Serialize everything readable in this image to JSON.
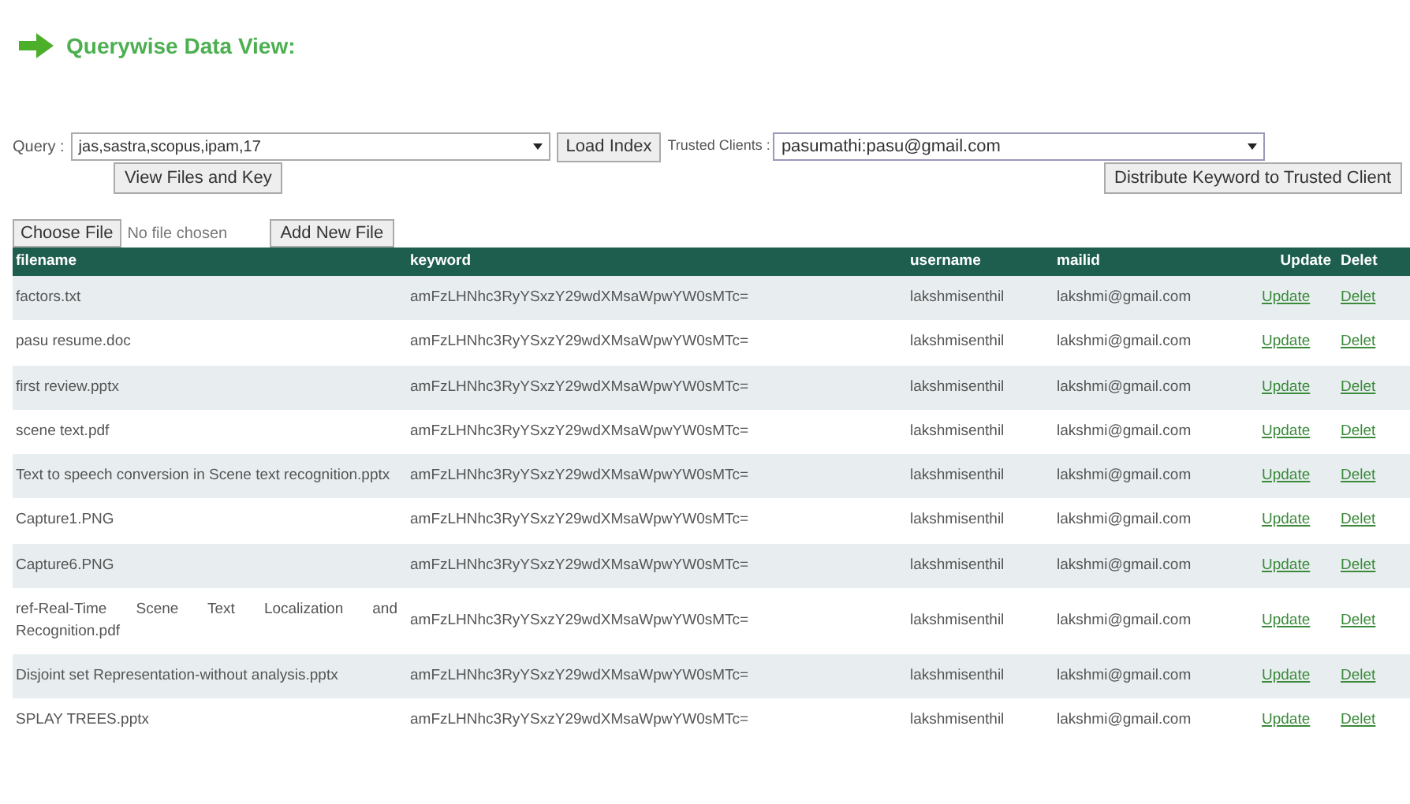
{
  "heading": "Querywise Data View:",
  "query": {
    "label": "Query :",
    "value": "jas,sastra,scopus,ipam,17"
  },
  "load_button": "Load Index",
  "trusted": {
    "label": "Trusted Clients :",
    "value": "pasumathi:pasu@gmail.com"
  },
  "view_button": "View Files and Key",
  "distribute_button": "Distribute Keyword to Trusted Client",
  "file_input": {
    "button": "Choose File",
    "status": "No file chosen"
  },
  "add_button": "Add New File",
  "table": {
    "columns": [
      "filename",
      "keyword",
      "username",
      "mailid",
      "Update",
      "Delet"
    ],
    "rows": [
      {
        "filename": "factors.txt",
        "keyword": "amFzLHNhc3RyYSxzY29wdXMsaWpwYW0sMTc=",
        "username": "lakshmisenthil",
        "mailid": "lakshmi@gmail.com",
        "update": "Update",
        "delete": "Delet"
      },
      {
        "filename": "pasu resume.doc",
        "keyword": "amFzLHNhc3RyYSxzY29wdXMsaWpwYW0sMTc=",
        "username": "lakshmisenthil",
        "mailid": "lakshmi@gmail.com",
        "update": "Update",
        "delete": "Delet"
      },
      {
        "filename": "first review.pptx",
        "keyword": "amFzLHNhc3RyYSxzY29wdXMsaWpwYW0sMTc=",
        "username": "lakshmisenthil",
        "mailid": "lakshmi@gmail.com",
        "update": "Update",
        "delete": "Delet"
      },
      {
        "filename": "scene text.pdf",
        "keyword": "amFzLHNhc3RyYSxzY29wdXMsaWpwYW0sMTc=",
        "username": "lakshmisenthil",
        "mailid": "lakshmi@gmail.com",
        "update": "Update",
        "delete": "Delet"
      },
      {
        "filename": "Text to speech conversion in Scene text recognition.pptx",
        "keyword": "amFzLHNhc3RyYSxzY29wdXMsaWpwYW0sMTc=",
        "username": "lakshmisenthil",
        "mailid": "lakshmi@gmail.com",
        "update": "Update",
        "delete": "Delet"
      },
      {
        "filename": "Capture1.PNG",
        "keyword": "amFzLHNhc3RyYSxzY29wdXMsaWpwYW0sMTc=",
        "username": "lakshmisenthil",
        "mailid": "lakshmi@gmail.com",
        "update": "Update",
        "delete": "Delet"
      },
      {
        "filename": "Capture6.PNG",
        "keyword": "amFzLHNhc3RyYSxzY29wdXMsaWpwYW0sMTc=",
        "username": "lakshmisenthil",
        "mailid": "lakshmi@gmail.com",
        "update": "Update",
        "delete": "Delet"
      },
      {
        "filename": "ref-Real-Time Scene Text Localization and Recognition.pdf",
        "keyword": "amFzLHNhc3RyYSxzY29wdXMsaWpwYW0sMTc=",
        "username": "lakshmisenthil",
        "mailid": "lakshmi@gmail.com",
        "update": "Update",
        "delete": "Delet"
      },
      {
        "filename": "Disjoint set Representation-without analysis.pptx",
        "keyword": "amFzLHNhc3RyYSxzY29wdXMsaWpwYW0sMTc=",
        "username": "lakshmisenthil",
        "mailid": "lakshmi@gmail.com",
        "update": "Update",
        "delete": "Delet"
      },
      {
        "filename": "SPLAY TREES.pptx",
        "keyword": "amFzLHNhc3RyYSxzY29wdXMsaWpwYW0sMTc=",
        "username": "lakshmisenthil",
        "mailid": "lakshmi@gmail.com",
        "update": "Update",
        "delete": "Delet"
      }
    ]
  }
}
